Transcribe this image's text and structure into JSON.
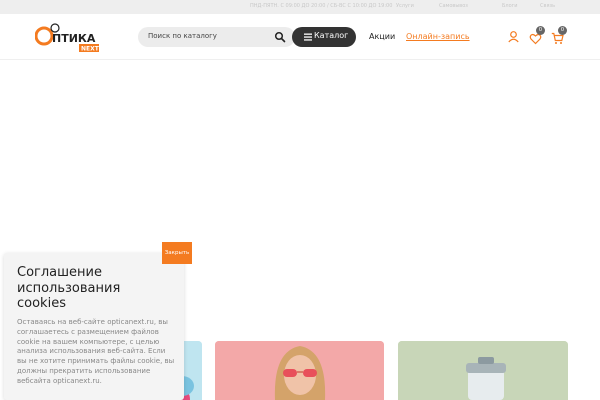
{
  "topbar": {
    "hours": "ПНД-ПЯТН. С 09:00 ДО 20:00 / СБ-ВС С 10:00 ДО 19:00",
    "links": [
      "Услуги",
      "Самовывоз",
      "Блоги",
      "Связь"
    ]
  },
  "logo": {
    "main": "ПТИКА",
    "sub": "NEXT"
  },
  "search": {
    "placeholder": "Поиск по каталогу"
  },
  "catalog": {
    "label": "Каталог"
  },
  "nav": {
    "promo": "Акции",
    "online": "Онлайн-запись"
  },
  "header_icons": {
    "favorites_count": "0",
    "cart_count": "0"
  },
  "cookie": {
    "title": "Соглашение использования cookies",
    "text": "Оставаясь на веб-сайте opticanext.ru, вы соглашаетесь с размещением файлов cookie на вашем компьютере, с целью анализа использования веб-сайта. Если вы не хотите принимать файлы cookie, вы должны прекратить использование вебсайта opticanext.ru.",
    "close": "Закрыть"
  },
  "colors": {
    "accent": "#f47b20",
    "dark": "#333333"
  }
}
